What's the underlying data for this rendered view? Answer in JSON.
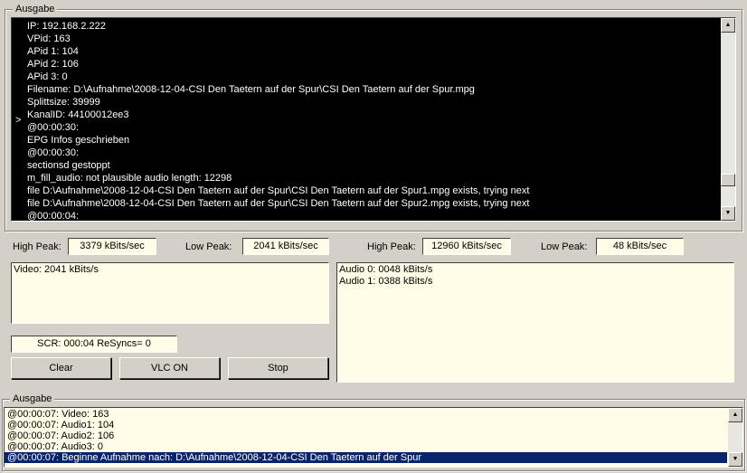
{
  "top_group": {
    "title": "Ausgabe",
    "console_marker": ">",
    "console_lines": [
      "IP: 192.168.2.222",
      "VPid: 163",
      "APid 1: 104",
      "APid 2: 106",
      "APid 3: 0",
      "Filename: D:\\Aufnahme\\2008-12-04-CSI Den Taetern auf der Spur\\CSI Den Taetern auf der Spur.mpg",
      "Splittsize: 39999",
      "KanalID: 44100012ee3",
      "@00:00:30:",
      "EPG Infos geschrieben",
      "@00:00:30:",
      "sectionsd gestoppt",
      "m_fill_audio: not plausible audio length: 12298",
      "file D:\\Aufnahme\\2008-12-04-CSI Den Taetern auf der Spur\\CSI Den Taetern auf der Spur1.mpg exists, trying next",
      "file D:\\Aufnahme\\2008-12-04-CSI Den Taetern auf der Spur\\CSI Den Taetern auf der Spur2.mpg exists, trying next",
      "@00:00:04:"
    ]
  },
  "peaks": {
    "video_high_label": "High Peak:",
    "video_high_value": "3379 kBits/sec",
    "video_low_label": "Low Peak:",
    "video_low_value": "2041 kBits/sec",
    "audio_high_label": "High Peak:",
    "audio_high_value": "12960 kBits/sec",
    "audio_low_label": "Low Peak:",
    "audio_low_value": "48 kBits/sec"
  },
  "video_box": {
    "lines": [
      "Video: 2041 kBits/s"
    ]
  },
  "audio_box": {
    "lines": [
      "Audio 0: 0048 kBits/s",
      "Audio 1: 0388 kBits/s"
    ]
  },
  "scr_status": "SCR: 000:04 ReSyncs= 0",
  "buttons": {
    "clear": "Clear",
    "vlc": "VLC ON",
    "stop": "Stop"
  },
  "bottom_group": {
    "title": "Ausgabe",
    "log_lines": [
      "@00:00:07: Video: 163",
      "@00:00:07: Audio1: 104",
      "@00:00:07: Audio2: 106",
      "@00:00:07: Audio3: 0",
      "@00:00:07: Beginne Aufnahme nach: D:\\Aufnahme\\2008-12-04-CSI Den Taetern auf der Spur"
    ],
    "selected_index": 4
  },
  "icons": {
    "scroll_up": "arrow-up-icon",
    "scroll_down": "arrow-down-icon"
  },
  "colors": {
    "console_bg": "#000000",
    "field_bg": "#fffde8",
    "selection": "#0a246a",
    "window_bg": "#d4d0c8"
  }
}
